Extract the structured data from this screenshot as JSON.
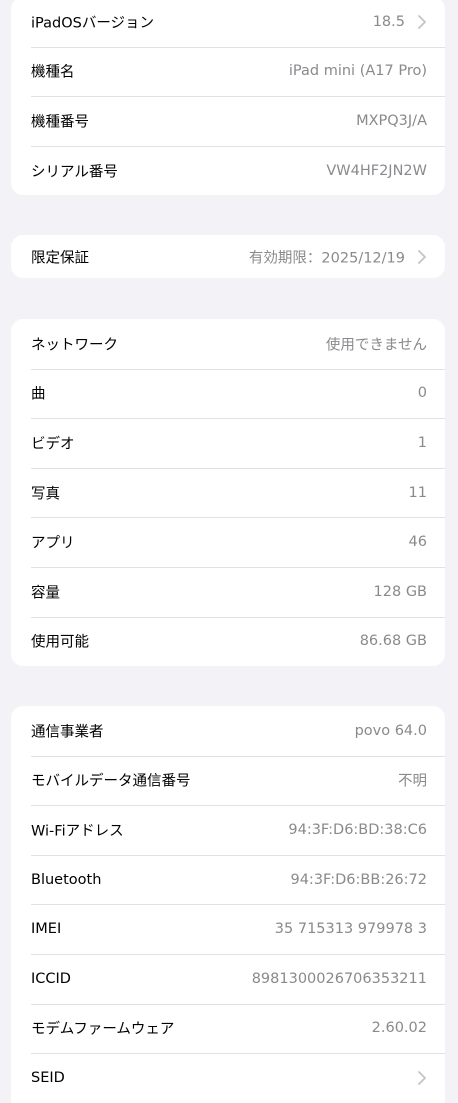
{
  "colors": {
    "background": "#f2f2f7",
    "card": "#ffffff",
    "label": "#000000",
    "value": "#8a8a8e",
    "separator": "#e0e0e5",
    "chevron": "#c4c4c7"
  },
  "groups": [
    {
      "rows": [
        {
          "label": "iPadOSバージョン",
          "value": "18.5",
          "chevron": true
        },
        {
          "label": "機種名",
          "value": "iPad mini (A17 Pro)",
          "chevron": false
        },
        {
          "label": "機種番号",
          "value": "MXPQ3J/A",
          "chevron": false
        },
        {
          "label": "シリアル番号",
          "value": "VW4HF2JN2W",
          "chevron": false
        }
      ]
    },
    {
      "rows": [
        {
          "label": "限定保証",
          "value": "有効期限：2025/12/19",
          "chevron": true
        }
      ]
    },
    {
      "rows": [
        {
          "label": "ネットワーク",
          "value": "使用できません",
          "chevron": false
        },
        {
          "label": "曲",
          "value": "0",
          "chevron": false
        },
        {
          "label": "ビデオ",
          "value": "1",
          "chevron": false
        },
        {
          "label": "写真",
          "value": "11",
          "chevron": false
        },
        {
          "label": "アプリ",
          "value": "46",
          "chevron": false
        },
        {
          "label": "容量",
          "value": "128 GB",
          "chevron": false
        },
        {
          "label": "使用可能",
          "value": "86.68 GB",
          "chevron": false
        }
      ]
    },
    {
      "rows": [
        {
          "label": "通信事業者",
          "value": "povo 64.0",
          "chevron": false
        },
        {
          "label": "モバイルデータ通信番号",
          "value": "不明",
          "chevron": false
        },
        {
          "label": "Wi-Fiアドレス",
          "value": "94:3F:D6:BD:38:C6",
          "chevron": false
        },
        {
          "label": "Bluetooth",
          "value": "94:3F:D6:BB:26:72",
          "chevron": false
        },
        {
          "label": "IMEI",
          "value": "35 715313 979978 3",
          "chevron": false
        },
        {
          "label": "ICCID",
          "value": "8981300026706353211",
          "chevron": false
        },
        {
          "label": "モデムファームウェア",
          "value": "2.60.02",
          "chevron": false
        },
        {
          "label": "SEID",
          "value": "",
          "chevron": true
        }
      ]
    }
  ]
}
